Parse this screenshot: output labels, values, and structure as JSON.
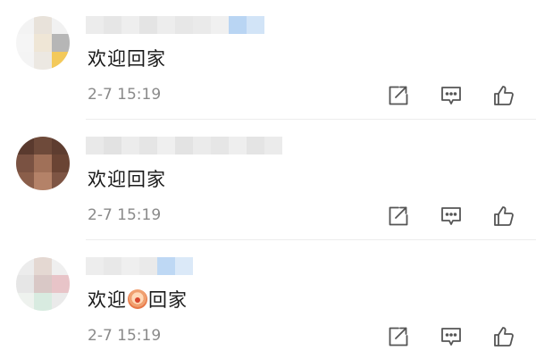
{
  "comments": [
    {
      "username": "",
      "text": "欢迎回家",
      "has_emoji": false,
      "timestamp": "2-7 15:19"
    },
    {
      "username": "",
      "text": "欢迎回家",
      "has_emoji": false,
      "timestamp": "2-7 15:19"
    },
    {
      "username": "",
      "text_before_emoji": "欢迎",
      "text_after_emoji": "回家",
      "has_emoji": true,
      "emoji": "smiley-emoji",
      "timestamp": "2-7 15:19"
    }
  ],
  "actions": {
    "share_icon": "share-icon",
    "reply_icon": "comment-icon",
    "like_icon": "thumbs-up-icon"
  },
  "colors": {
    "text": "#1a1a1a",
    "meta": "#8a8a8a",
    "icon": "#555555",
    "divider": "#ececec"
  }
}
